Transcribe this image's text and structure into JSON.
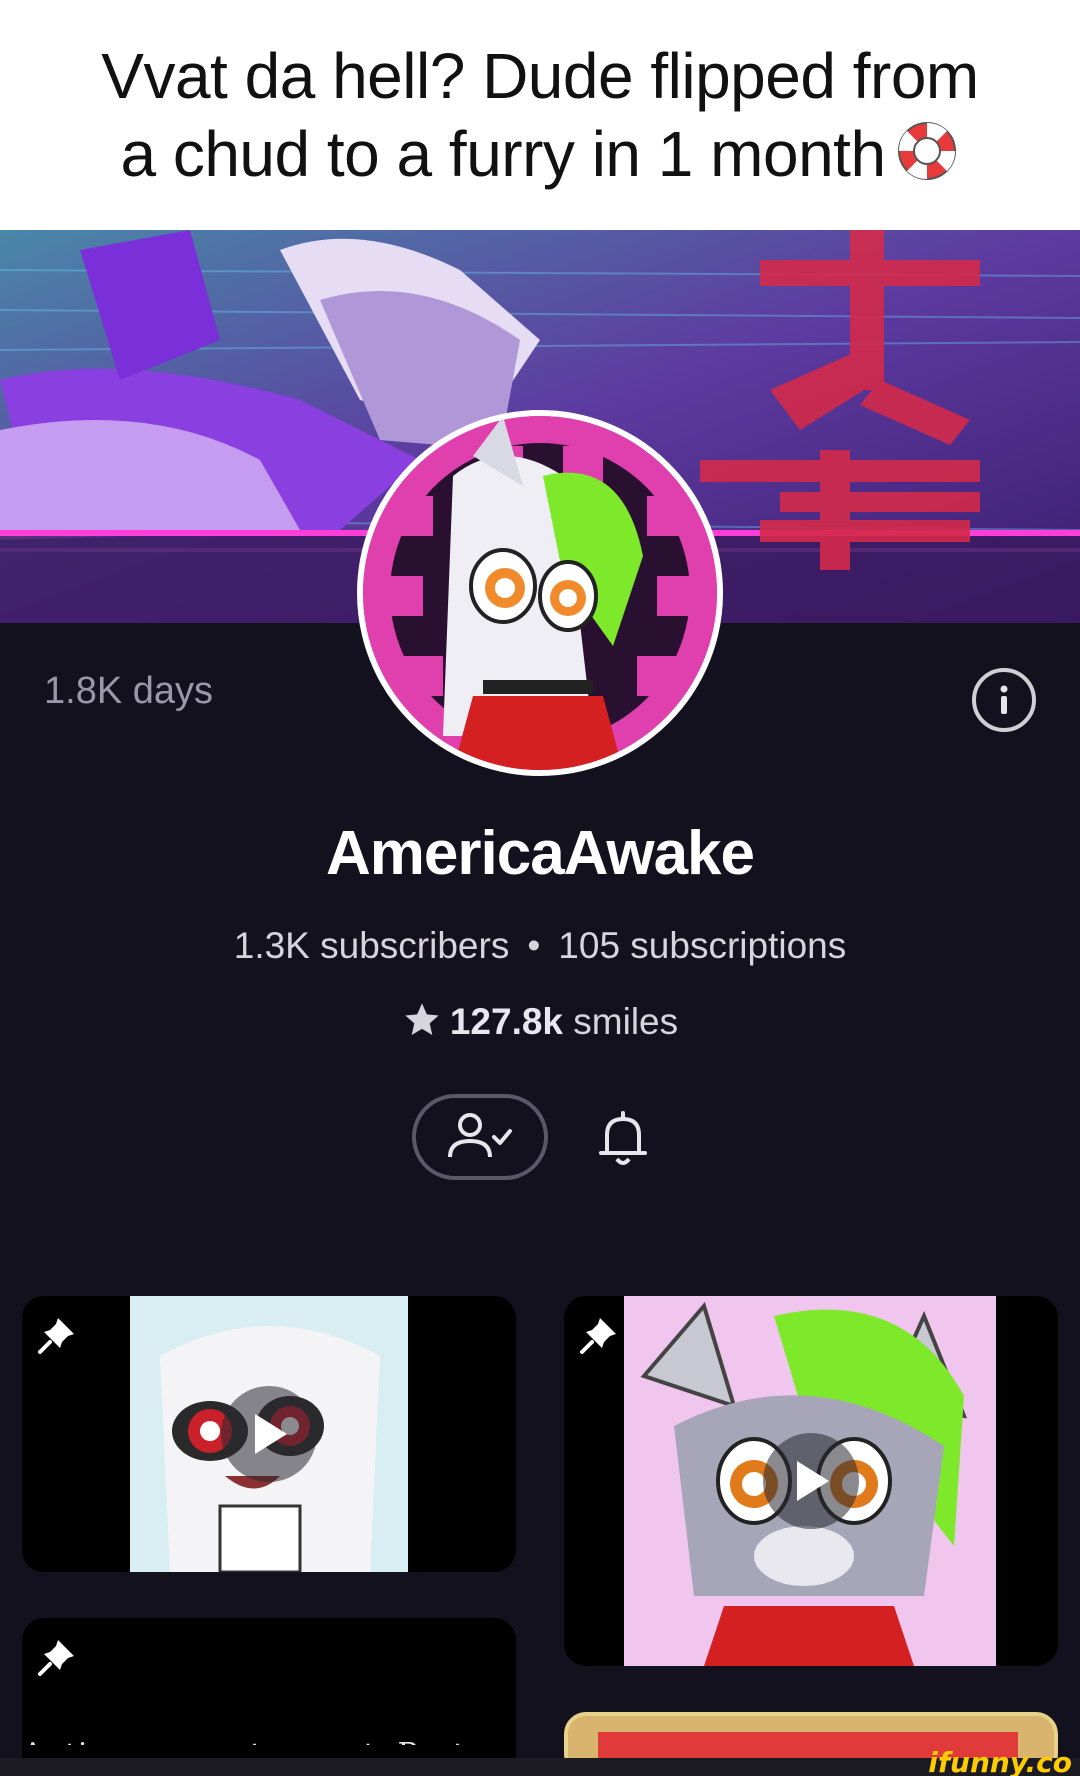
{
  "caption": {
    "line1": "Vvat da hell? Dude flipped from",
    "line2": "a chud to a furry in 1 month"
  },
  "caption_emoji": "lifebuoy-icon",
  "profile": {
    "age": "1.8K days",
    "username": "AmericaAwake",
    "subscribers": "1.3K subscribers",
    "separator": "•",
    "subscriptions": "105 subscriptions",
    "smiles_count": "127.8k",
    "smiles_label": "smiles"
  },
  "actions": {
    "info": "info-icon",
    "subscribed": "user-check-icon",
    "notifications": "bell-icon"
  },
  "posts": [
    {
      "pinned": true,
      "type": "video"
    },
    {
      "pinned": true,
      "type": "video"
    },
    {
      "pinned": true,
      "type": "text",
      "text": "Anti-porn master post. Post"
    },
    {
      "pinned": false,
      "type": "image"
    }
  ],
  "watermark": "ifunny.co",
  "colors": {
    "background": "#14111e",
    "banner_red": "#d42a4a",
    "accent_green": "#7ee82a",
    "watermark": "#ffcc00"
  }
}
